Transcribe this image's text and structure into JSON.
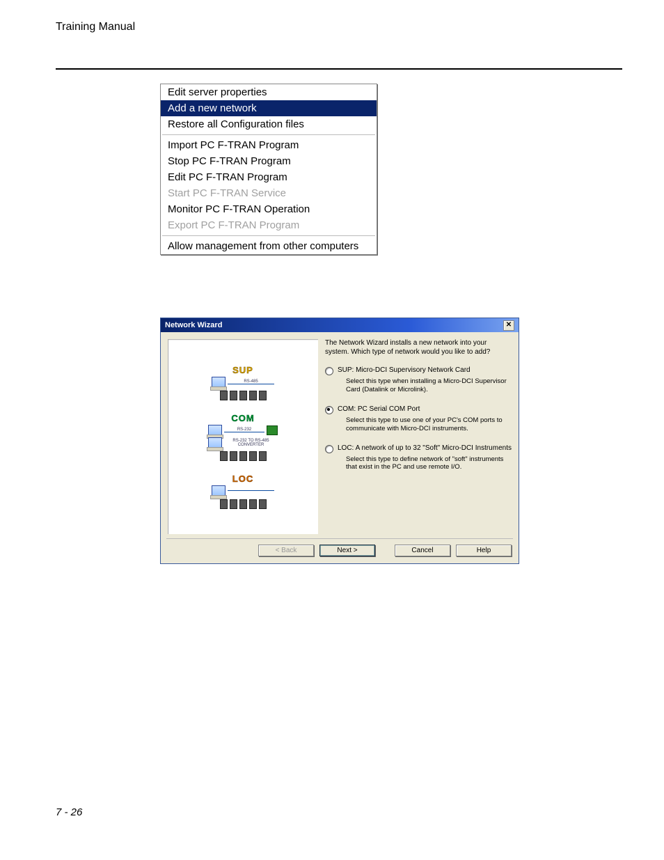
{
  "doc": {
    "header": "Training Manual",
    "footer": "7 - 26"
  },
  "menu": {
    "items": [
      {
        "label": "Edit server properties",
        "state": "normal"
      },
      {
        "label": "Add a new network",
        "state": "selected"
      },
      {
        "label": "Restore all Configuration files",
        "state": "normal"
      },
      {
        "sep": true
      },
      {
        "label": "Import PC F-TRAN Program",
        "state": "normal"
      },
      {
        "label": "Stop PC F-TRAN Program",
        "state": "normal"
      },
      {
        "label": "Edit PC F-TRAN Program",
        "state": "normal"
      },
      {
        "label": "Start PC F-TRAN Service",
        "state": "disabled"
      },
      {
        "label": "Monitor PC F-TRAN Operation",
        "state": "normal"
      },
      {
        "label": "Export PC F-TRAN Program",
        "state": "disabled"
      },
      {
        "sep": true
      },
      {
        "label": "Allow management from other computers",
        "state": "normal"
      }
    ]
  },
  "wizard": {
    "title": "Network Wizard",
    "intro": "The Network Wizard installs a new network into your system. Which type of network would you like to add?",
    "options": [
      {
        "key": "SUP",
        "selected": false,
        "label": "SUP: Micro-DCI Supervisory Network Card",
        "desc": "Select this type when installing a Micro-DCI Supervisor Card (Datalink or Microlink)."
      },
      {
        "key": "COM",
        "selected": true,
        "label": "COM: PC Serial COM Port",
        "desc": "Select this type to use one of your PC's COM ports to communicate with Micro-DCI instruments."
      },
      {
        "key": "LOC",
        "selected": false,
        "label": "LOC: A network of up to 32 \"Soft\" Micro-DCI Instruments",
        "desc": "Select this type to define network of \"soft\" instruments that exist in the PC and use remote I/O."
      }
    ],
    "left_panel": {
      "sup": {
        "tag": "SUP",
        "link": "RS-485"
      },
      "com": {
        "tag": "COM",
        "link1": "RS-232",
        "conv": "RS-232 TO RS-485\nCONVERTER"
      },
      "loc": {
        "tag": "LOC"
      }
    },
    "buttons": {
      "back": "< Back",
      "next": "Next >",
      "cancel": "Cancel",
      "help": "Help"
    }
  }
}
